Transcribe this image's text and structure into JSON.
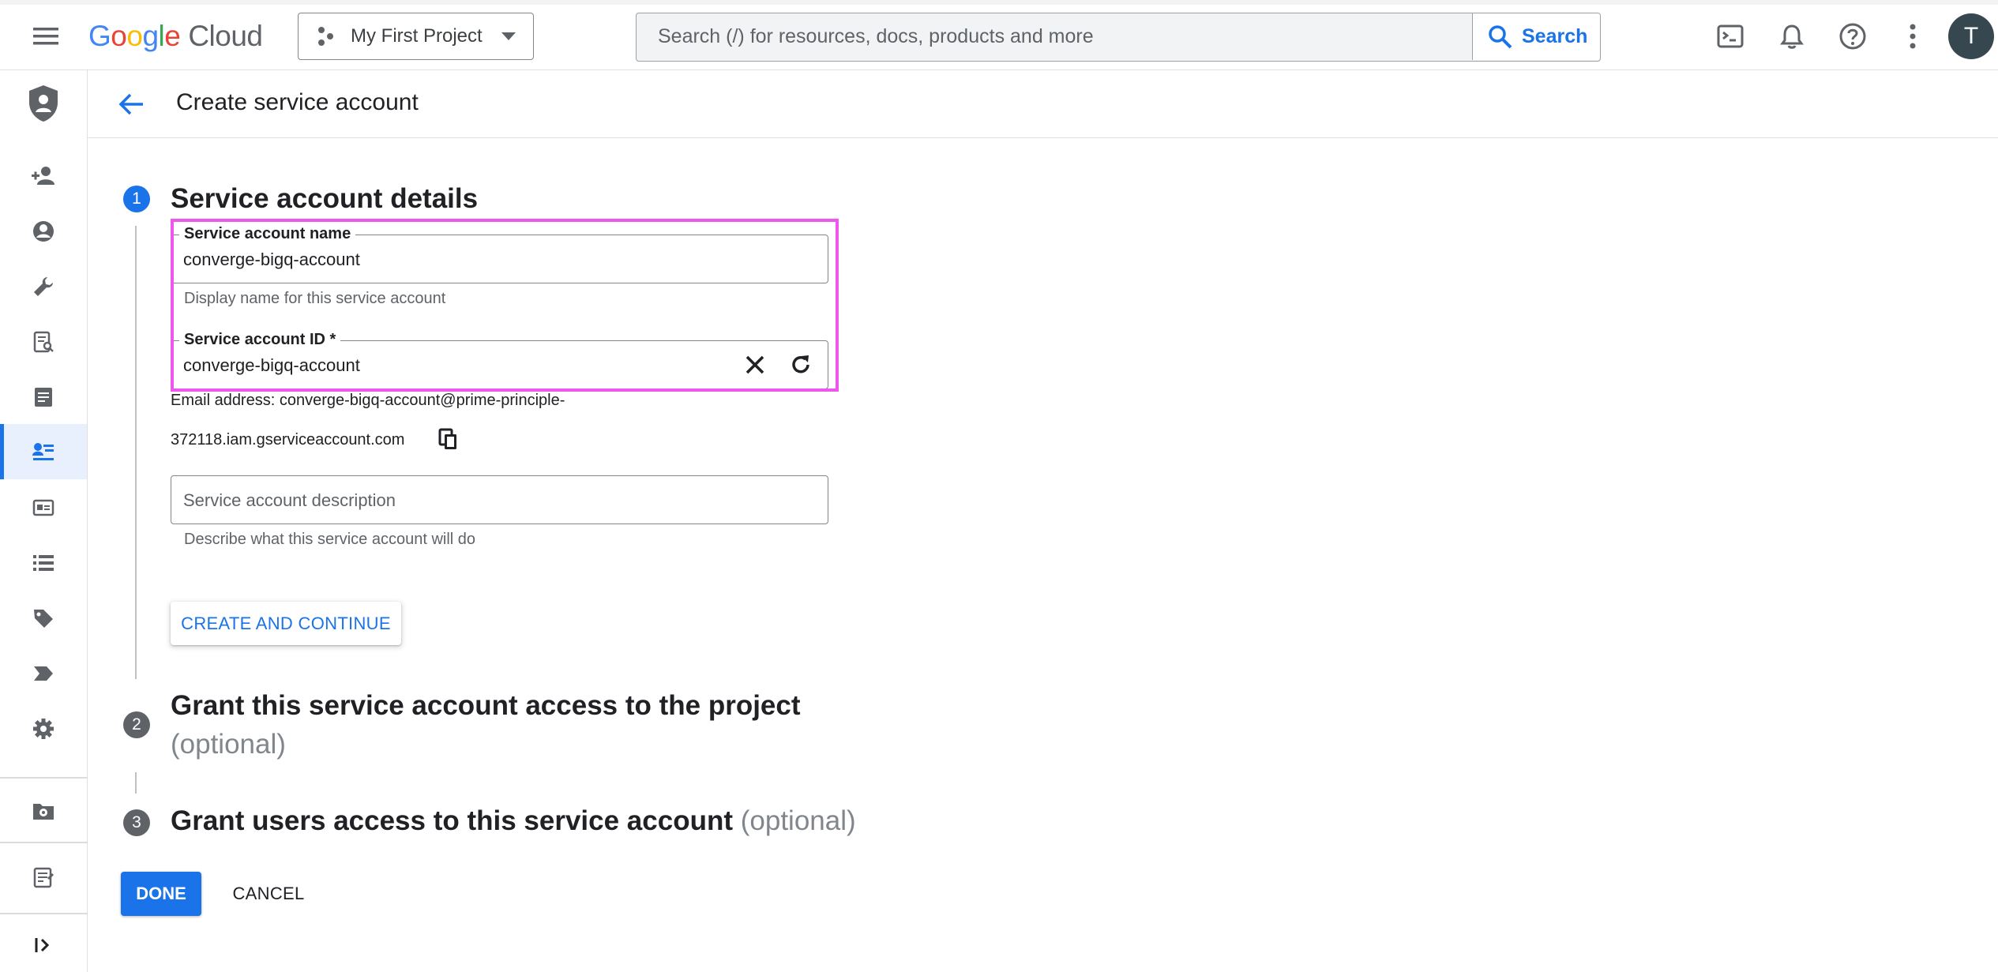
{
  "header": {
    "logo_google": "Google",
    "logo_cloud": "Cloud",
    "project_name": "My First Project",
    "search_placeholder": "Search (/) for resources, docs, products and more",
    "search_button_label": "Search",
    "avatar_initial": "T"
  },
  "page": {
    "title": "Create service account"
  },
  "steps": [
    {
      "number": "1",
      "title": "Service account details",
      "optional": ""
    },
    {
      "number": "2",
      "title_line1": "Grant this service account access to the project",
      "optional": "(optional)"
    },
    {
      "number": "3",
      "title": "Grant users access to this service account",
      "optional": "(optional)"
    }
  ],
  "form": {
    "name_label": "Service account name",
    "name_value": "converge-bigq-account",
    "name_helper": "Display name for this service account",
    "id_label": "Service account ID *",
    "id_value": "converge-bigq-account",
    "email_line1": "Email address: converge-bigq-account@prime-principle-",
    "email_line2": "372118.iam.gserviceaccount.com",
    "description_placeholder": "Service account description",
    "description_helper": "Describe what this service account will do",
    "create_button": "CREATE AND CONTINUE"
  },
  "actions": {
    "done": "DONE",
    "cancel": "CANCEL"
  },
  "colors": {
    "accent": "#1a73e8",
    "highlight": "#ee57ee",
    "step_active": "#1a73e8",
    "step_inactive": "#5f6368"
  },
  "rail_icons": [
    "iam-shield-icon",
    "add-person-icon",
    "account-circle-icon",
    "wrench-icon",
    "policy-analyzer-icon",
    "audit-log-icon",
    "service-accounts-icon",
    "workload-identity-icon",
    "roles-list-icon",
    "tags-icon",
    "labels-icon",
    "settings-icon",
    "manage-resources-icon",
    "release-notes-icon",
    "expand-rail-icon"
  ]
}
